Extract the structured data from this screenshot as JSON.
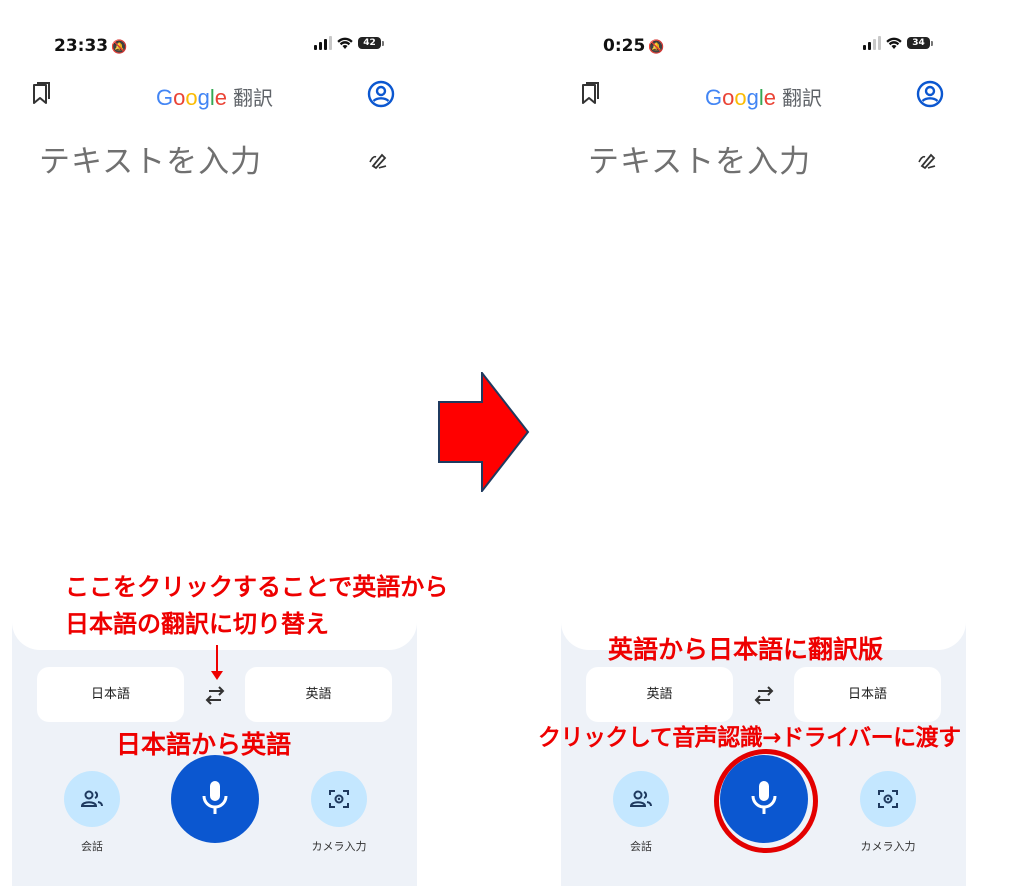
{
  "left_screen": {
    "status_time": "23:33",
    "battery": "42",
    "app_title_brand": "Google",
    "app_title_suffix": "翻訳",
    "input_placeholder": "テキストを入力",
    "source_language": "日本語",
    "target_language": "英語",
    "conversation_label": "会話",
    "camera_label": "カメラ入力"
  },
  "right_screen": {
    "status_time": "0:25",
    "battery": "34",
    "app_title_brand": "Google",
    "app_title_suffix": "翻訳",
    "input_placeholder": "テキストを入力",
    "source_language": "英語",
    "target_language": "日本語",
    "conversation_label": "会話",
    "camera_label": "カメラ入力"
  },
  "annotations": {
    "swap_hint_line1": "ここをクリックすることで英語から",
    "swap_hint_line2": "日本語の翻訳に切り替え",
    "left_direction": "日本語から英語",
    "right_direction": "英語から日本語に翻訳版",
    "mic_hint": "クリックして音声認識→ドライバーに渡す"
  },
  "colors": {
    "annotation_red": "#ee0000",
    "mic_blue": "#0b57d0",
    "panel_bg": "#eef2f8",
    "light_button": "#c4e7ff",
    "arrow_red": "#ff0000"
  },
  "icons": {
    "bookmark": "bookmark-icon",
    "account": "account-circle-icon",
    "handwrite": "handwrite-icon",
    "swap": "swap-icon",
    "conversation": "people-icon",
    "camera": "camera-lens-icon",
    "mic": "mic-icon",
    "silent": "bell-slash-icon"
  }
}
